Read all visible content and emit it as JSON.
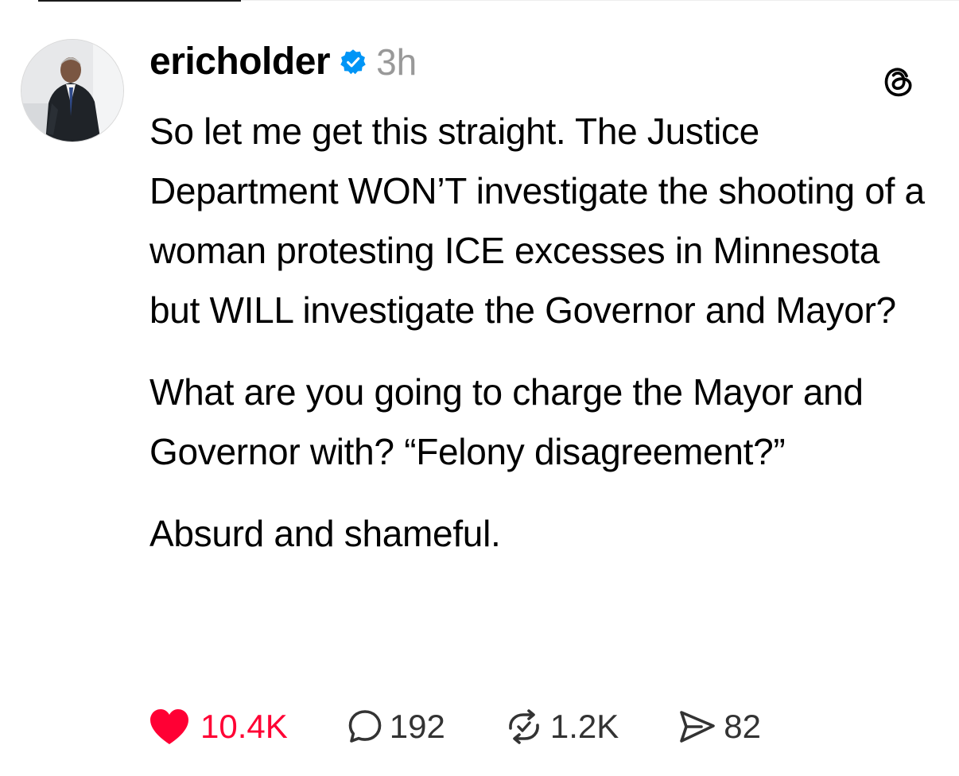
{
  "post": {
    "username": "ericholder",
    "verified": true,
    "time_ago": "3h",
    "paragraphs": [
      "So let me get this straight. The Justice Department WON’T investigate the shooting of a woman protesting ICE excesses in Minnesota but WILL investigate the Governor and Mayor?",
      "What are you going to charge the Mayor and Governor with? “Felony disagreement?”",
      "Absurd and shameful."
    ]
  },
  "actions": {
    "likes": {
      "icon": "heart-icon",
      "count": "10.4K",
      "liked": true,
      "color": "#ff0034"
    },
    "replies": {
      "icon": "reply-bubble-icon",
      "count": "192"
    },
    "reposts": {
      "icon": "repost-icon",
      "count": "1.2K"
    },
    "shares": {
      "icon": "send-icon",
      "count": "82"
    }
  },
  "icons": {
    "verified": "verified-badge-icon",
    "app": "threads-logo-icon"
  },
  "colors": {
    "text": "#000000",
    "muted": "#999999",
    "verified": "#0095f6",
    "like": "#ff0034",
    "action_text": "#333333"
  }
}
